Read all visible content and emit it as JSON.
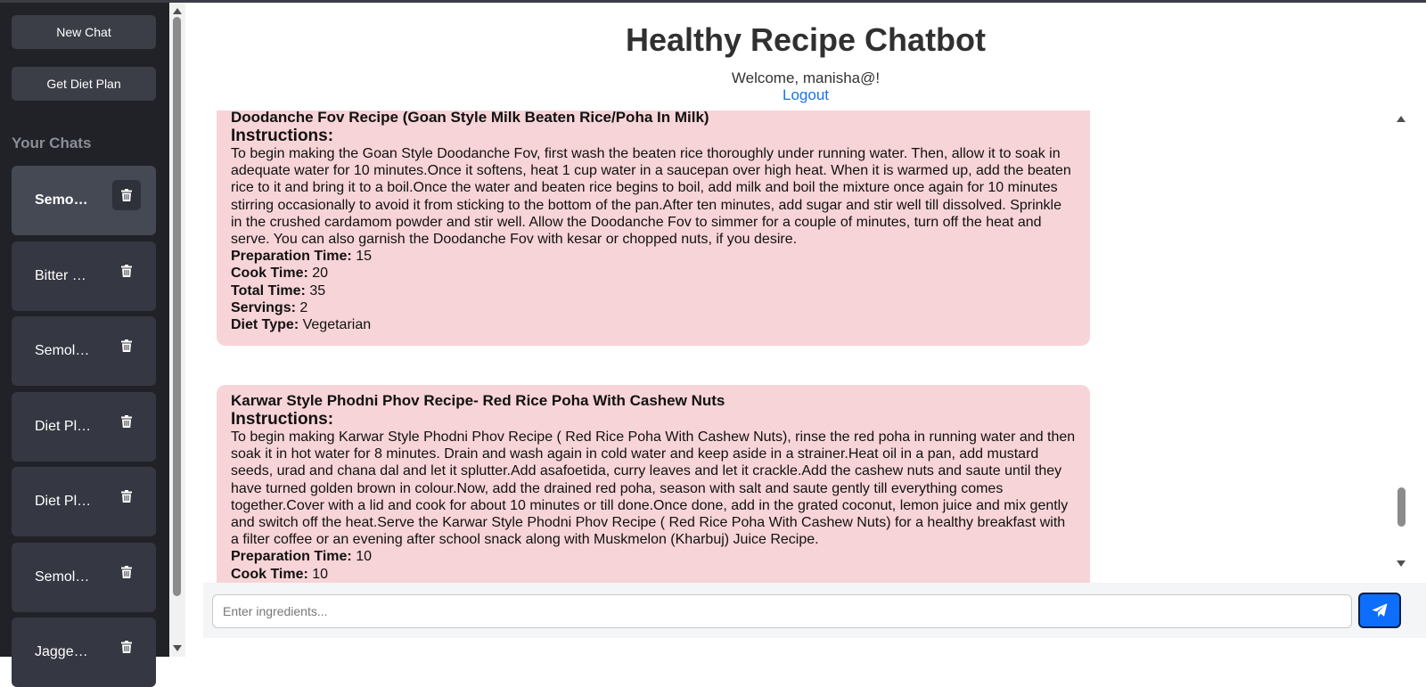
{
  "sidebar": {
    "new_chat": "New Chat",
    "diet_plan": "Get Diet Plan",
    "your_chats": "Your Chats",
    "chats": [
      {
        "label": "Semo…"
      },
      {
        "label": "Bitter …"
      },
      {
        "label": "Semol…"
      },
      {
        "label": "Diet Pl…"
      },
      {
        "label": "Diet Pl…"
      },
      {
        "label": "Semol…"
      },
      {
        "label": "Jagge…"
      }
    ]
  },
  "header": {
    "title": "Healthy Recipe Chatbot",
    "welcome": "Welcome, manisha@!",
    "logout": "Logout"
  },
  "messages": [
    {
      "title": "Doodanche Fov Recipe (Goan Style Milk Beaten Rice/Poha In Milk)",
      "instructions_heading": "Instructions:",
      "instructions": "To begin making the Goan Style Doodanche Fov, first wash the beaten rice thoroughly under running water. Then, allow it to soak in adequate water for 10 minutes.Once it softens, heat 1 cup water in a saucepan over high heat. When it is warmed up, add the beaten rice to it and bring it to a boil.Once the water and beaten rice begins to boil, add milk and boil the mixture once again for 10 minutes stirring occasionally to avoid it from sticking to the bottom of the pan.After ten minutes, add sugar and stir well till dissolved. Sprinkle in the crushed cardamom powder and stir well. Allow the Doodanche Fov to simmer for a couple of minutes, turn off the heat and serve. You can also garnish the Doodanche Fov with kesar or chopped nuts, if you desire.",
      "prep_label": "Preparation Time:",
      "prep": "15",
      "cook_label": "Cook Time:",
      "cook": "20",
      "total_label": "Total Time:",
      "total": "35",
      "servings_label": "Servings:",
      "servings": "2",
      "diet_label": "Diet Type:",
      "diet": "Vegetarian"
    },
    {
      "title": "Karwar Style Phodni Phov Recipe- Red Rice Poha With Cashew Nuts",
      "instructions_heading": "Instructions:",
      "instructions": "To begin making Karwar Style Phodni Phov Recipe ( Red Rice Poha With Cashew Nuts), rinse the red poha in running water and then soak it in hot water for 8 minutes. Drain and wash again in cold water and keep aside in a strainer.Heat oil in a pan, add mustard seeds, urad and chana dal and let it splutter.Add asafoetida, curry leaves and let it crackle.Add the cashew nuts and saute until they have turned golden brown in colour.Now, add the drained red poha, season with salt and saute gently till everything comes together.Cover with a lid and cook for about 10 minutes or till done.Once done, add in the grated coconut, lemon juice and mix gently and switch off the heat.Serve the Karwar Style Phodni Phov Recipe ( Red Rice Poha With Cashew Nuts) for a healthy breakfast with a filter coffee or an evening after school snack along with Muskmelon (Kharbuj) Juice Recipe.",
      "prep_label": "Preparation Time:",
      "prep": "10",
      "cook_label": "Cook Time:",
      "cook": "10"
    }
  ],
  "input": {
    "placeholder": "Enter ingredients..."
  },
  "icons": {
    "trash": "trash-icon",
    "send": "paper-plane-icon"
  },
  "colors": {
    "sidebar_bg": "#202227",
    "card_bg": "#f7d4d8",
    "accent": "#0d6efd",
    "link": "#1a73e8"
  }
}
